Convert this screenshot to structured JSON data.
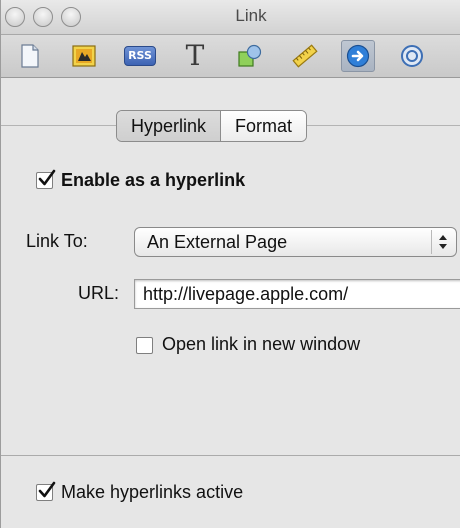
{
  "window": {
    "title": "Link"
  },
  "toolbar": {
    "icons": [
      "document-icon",
      "media-icon",
      "rss-icon",
      "text-icon",
      "shapes-icon",
      "ruler-icon",
      "link-icon",
      "partial-icon"
    ],
    "rss_label": "RSS",
    "text_glyph": "T",
    "selected_index": 6
  },
  "tabs": {
    "hyperlink": "Hyperlink",
    "format": "Format",
    "selected": "Hyperlink"
  },
  "hyperlink": {
    "enable_label": "Enable as a hyperlink",
    "enable_checked": true,
    "link_to_label": "Link To:",
    "link_to_value": "An External Page",
    "url_label": "URL:",
    "url_value": "http://livepage.apple.com/",
    "new_window_label": "Open link in new window",
    "new_window_checked": false
  },
  "footer": {
    "active_label": "Make hyperlinks active",
    "active_checked": true
  },
  "colors": {
    "panel_bg": "#e6e6e6",
    "selected_tool": "#a9b3c1",
    "link_blue": "#2f7fd8"
  }
}
